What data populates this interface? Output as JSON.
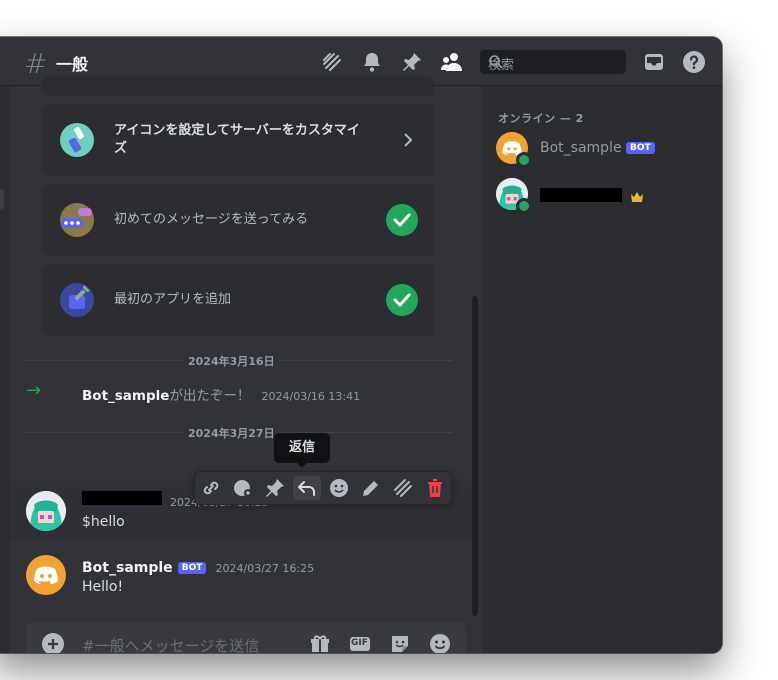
{
  "header": {
    "channel_hash": "#",
    "channel_name": "一般",
    "search_placeholder": "検索"
  },
  "setup_cards": [
    {
      "text_line1": "アイコンを設定してサーバーをカスタマイ",
      "text_line2": "ズ",
      "done": false
    },
    {
      "text": "初めてのメッセージを送ってみる",
      "done": true
    },
    {
      "text": "最初のアプリを追加",
      "done": true
    }
  ],
  "dividers": [
    {
      "label": "2024年3月16日"
    },
    {
      "label": "2024年3月27日"
    }
  ],
  "join_message": {
    "arrow": "→",
    "name": "Bot_sample",
    "text": "が出たぞー！",
    "time": "2024/03/16 13:41"
  },
  "tooltip": "返信",
  "messages": [
    {
      "time": "2024/03/27 16:25",
      "text": "$hello"
    },
    {
      "name": "Bot_sample",
      "badge": "BOT",
      "time": "2024/03/27 16:25",
      "text": "Hello!"
    }
  ],
  "composer": {
    "placeholder": "#一般へメッセージを送信",
    "gif_label": "GIF"
  },
  "members": {
    "section_label": "オンライン — 2",
    "list": [
      {
        "name": "Bot_sample",
        "badge": "BOT"
      },
      {
        "name": ""
      }
    ]
  },
  "colors": {
    "background": "#313338",
    "sidebar": "#2b2d31",
    "brand": "#5865f2",
    "online": "#23a55a",
    "danger": "#f23f43",
    "bot_avatar": "#f0a234"
  }
}
